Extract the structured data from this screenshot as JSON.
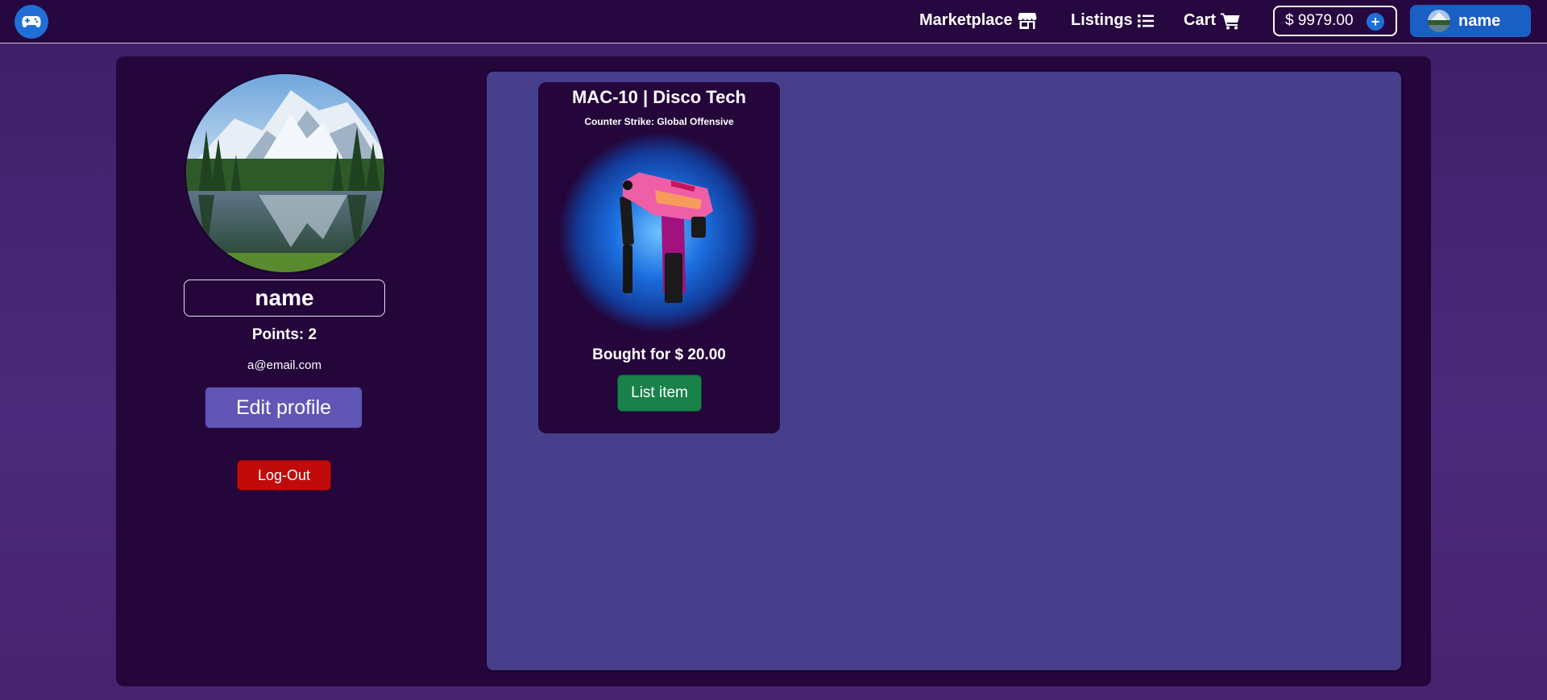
{
  "nav": {
    "logo_icon": "gamepad-icon",
    "links": [
      {
        "label": "Marketplace",
        "icon": "store-icon"
      },
      {
        "label": "Listings",
        "icon": "list-icon"
      },
      {
        "label": "Cart",
        "icon": "cart-icon"
      }
    ],
    "balance": "$ 9979.00",
    "add_funds_icon": "plus-icon",
    "user_name": "name"
  },
  "profile": {
    "name": "name",
    "points": "Points: 2",
    "email": "a@email.com",
    "edit_label": "Edit profile",
    "logout_label": "Log-Out"
  },
  "inventory": {
    "items": [
      {
        "title": "MAC-10 | Disco Tech",
        "game": "Counter Strike: Global Offensive",
        "price": "Bought for $ 20.00",
        "action_label": "List item"
      }
    ]
  },
  "colors": {
    "navbar": "#26073f",
    "panel": "#24063b",
    "inventory_bg": "#473e8c",
    "primary_blue": "#1f6fd6",
    "edit_button": "#6155b5",
    "logout_button": "#c10b0b",
    "list_button": "#19814a"
  }
}
